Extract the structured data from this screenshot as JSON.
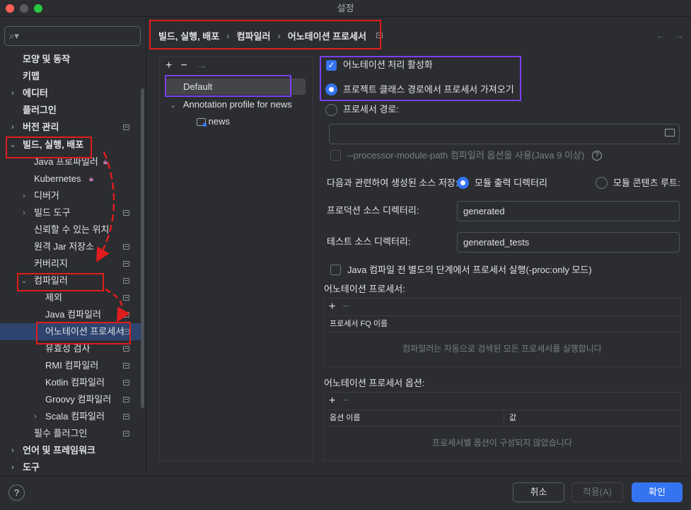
{
  "window": {
    "title": "설정"
  },
  "sidebar": {
    "search_placeholder": "",
    "items": [
      {
        "label": "모양 및 동작"
      },
      {
        "label": "키맵"
      },
      {
        "label": "에디터"
      },
      {
        "label": "플러그인"
      },
      {
        "label": "버전 관리"
      },
      {
        "label": "빌드, 실행, 배포"
      },
      {
        "label": "Java 프로파일러"
      },
      {
        "label": "Kubernetes"
      },
      {
        "label": "디버거"
      },
      {
        "label": "빌드 도구"
      },
      {
        "label": "신뢰할 수 있는 위치"
      },
      {
        "label": "원격 Jar 저장소"
      },
      {
        "label": "커버리지"
      },
      {
        "label": "컴파일러"
      },
      {
        "label": "제외"
      },
      {
        "label": "Java 컴파일러"
      },
      {
        "label": "어노테이션 프로세서"
      },
      {
        "label": "유효성 검사"
      },
      {
        "label": "RMI 컴파일러"
      },
      {
        "label": "Kotlin 컴파일러"
      },
      {
        "label": "Groovy 컴파일러"
      },
      {
        "label": "Scala 컴파일러"
      },
      {
        "label": "필수 플러그인"
      },
      {
        "label": "언어 및 프레임워크"
      },
      {
        "label": "도구"
      }
    ]
  },
  "breadcrumb": {
    "part1": "빌드, 실행, 배포",
    "part2": "컴파일러",
    "part3": "어노테이션 프로세서"
  },
  "profiles": {
    "default_label": "Default",
    "profile_label": "Annotation profile for news",
    "module_label": "news"
  },
  "settings": {
    "enable_processing": "어노테이션 처리 활성화",
    "obtain_from_classpath": "프로젝트 클래스 경로에서 프로세서 가져오기",
    "processor_path": "프로세서 경로:",
    "processor_module_path": "--processor-module-path 컴파일러 옵션을 사용(Java 9 이상)",
    "store_generated_sources": "다음과 관련하여 생성된 소스 저장:",
    "module_output_dir": "모듈 출력 디렉터리",
    "module_content_root": "모듈 콘텐츠 루트:",
    "production_sources_label": "프로덕션 소스 디렉터리:",
    "production_sources_value": "generated",
    "test_sources_label": "테스트 소스 디렉터리:",
    "test_sources_value": "generated_tests",
    "run_separately": "Java 컴파일 전 별도의 단계에서 프로세서 실행(-proc:only 모드)",
    "annotation_processors_title": "어노테이션 프로세서:",
    "processor_fq_name_header": "프로세서 FQ 이름",
    "processors_empty": "컴파일러는 자동으로 검색된 모든 프로세서를 실행합니다",
    "processor_options_title": "어노테이션 프로세서 옵션:",
    "option_name_header": "옵션 이름",
    "option_value_header": "값",
    "options_empty": "프로세서별 옵션이 구성되지 않았습니다"
  },
  "footer": {
    "cancel": "취소",
    "apply": "적용(A)",
    "ok": "확인"
  },
  "colors": {
    "accent": "#3574f0",
    "annotation_red": "#e01d1d",
    "annotation_purple": "#7b3ff0"
  }
}
